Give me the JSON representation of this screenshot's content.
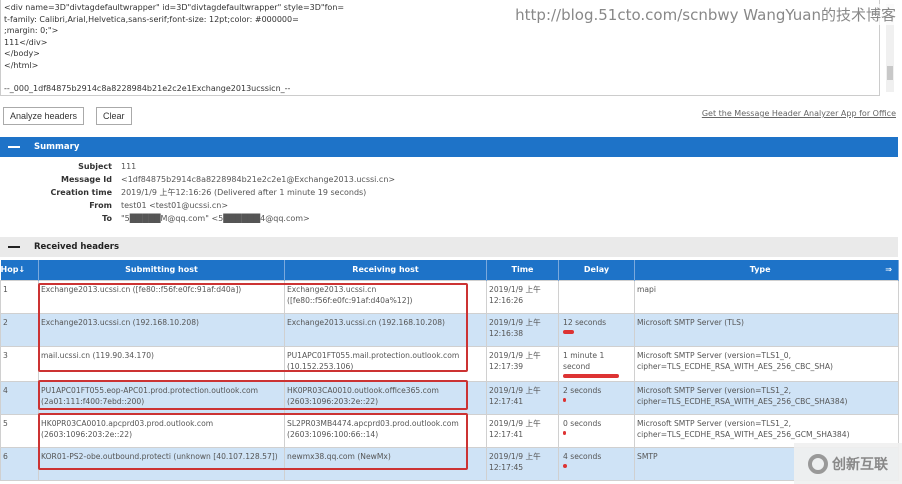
{
  "watermark": "http://blog.51cto.com/scnbwy WangYuan的技术博客",
  "raw_lines": [
    "<div name=3D\"divtagdefaultwrapper\" id=3D\"divtagdefaultwrapper\" style=3D\"fon=",
    "t-family: Calibri,Arial,Helvetica,sans-serif;font-size: 12pt;color: #000000=",
    ";margin: 0;\">",
    "111</div>",
    "</body>",
    "</html>",
    "",
    "--_000_1df84875b2914c8a8228984b21e2c2e1Exchange2013ucssicn_--"
  ],
  "buttons": {
    "analyze": "Analyze headers",
    "clear": "Clear"
  },
  "get_app_link": "Get the Message Header Analyzer App for Office",
  "summary": {
    "title": "Summary",
    "rows": [
      {
        "label": "Subject",
        "value": "111"
      },
      {
        "label": "Message Id",
        "value": "<1df84875b2914c8a8228984b21e2c2e1@Exchange2013.ucssi.cn>"
      },
      {
        "label": "Creation time",
        "value": "2019/1/9 上午12:16:26 (Delivered after 1 minute 19 seconds)"
      },
      {
        "label": "From",
        "value": "test01 <test01@ucssi.cn>"
      },
      {
        "label": "To",
        "value": "\"5█████M@qq.com\" <5██████4@qq.com>"
      }
    ]
  },
  "received": {
    "title": "Received headers",
    "columns": [
      "Hop↓",
      "Submitting host",
      "Receiving host",
      "Time",
      "Delay",
      "Type"
    ],
    "rows": [
      {
        "hop": "1",
        "from": "Exchange2013.ucssi.cn ([fe80::f56f:e0fc:91af:d40a])",
        "to": "Exchange2013.ucssi.cn ([fe80::f56f:e0fc:91af:d40a%12])",
        "time": "2019/1/9 上午 12:16:26",
        "delay": "",
        "delay_fraction": 0,
        "type": "mapi"
      },
      {
        "hop": "2",
        "from": "Exchange2013.ucssi.cn (192.168.10.208)",
        "to": "Exchange2013.ucssi.cn (192.168.10.208)",
        "time": "2019/1/9 上午 12:16:38",
        "delay": "12 seconds",
        "delay_fraction": 0.197,
        "type": "Microsoft SMTP Server (TLS)"
      },
      {
        "hop": "3",
        "from": "mail.ucssi.cn (119.90.34.170)",
        "to": "PU1APC01FT055.mail.protection.outlook.com (10.152.253.106)",
        "time": "2019/1/9 上午 12:17:39",
        "delay": "1 minute 1 second",
        "delay_fraction": 1,
        "type": "Microsoft SMTP Server (version=TLS1_0, cipher=TLS_ECDHE_RSA_WITH_AES_256_CBC_SHA)"
      },
      {
        "hop": "4",
        "from": "PU1APC01FT055.eop-APC01.prod.protection.outlook.com (2a01:111:f400:7ebd::200)",
        "to": "HK0PR03CA0010.outlook.office365.com (2603:1096:203:2e::22)",
        "time": "2019/1/9 上午 12:17:41",
        "delay": "2 seconds",
        "delay_fraction": 0.033,
        "type": "Microsoft SMTP Server (version=TLS1_2, cipher=TLS_ECDHE_RSA_WITH_AES_256_CBC_SHA384)"
      },
      {
        "hop": "5",
        "from": "HK0PR03CA0010.apcprd03.prod.outlook.com (2603:1096:203:2e::22)",
        "to": "SL2PR03MB4474.apcprd03.prod.outlook.com (2603:1096:100:66::14)",
        "time": "2019/1/9 上午 12:17:41",
        "delay": "0 seconds",
        "delay_fraction": 0,
        "type": "Microsoft SMTP Server (version=TLS1_2, cipher=TLS_ECDHE_RSA_WITH_AES_256_GCM_SHA384)"
      },
      {
        "hop": "6",
        "from": "KOR01-PS2-obe.outbound.protecti (unknown [40.107.128.57])",
        "to": "newmx38.qq.com (NewMx)",
        "time": "2019/1/9 上午 12:17:45",
        "delay": "4 seconds",
        "delay_fraction": 0.066,
        "type": "SMTP"
      }
    ]
  },
  "logo": "创新互联"
}
